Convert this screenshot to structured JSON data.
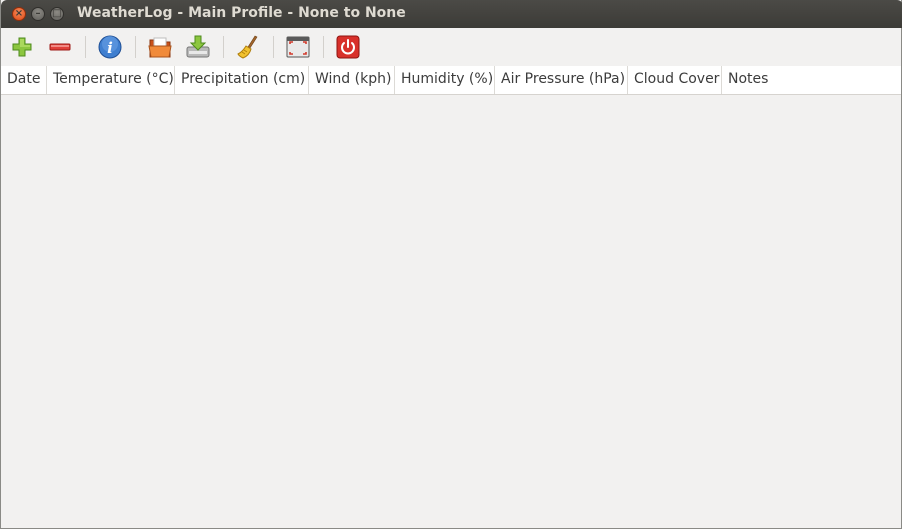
{
  "window": {
    "title": "WeatherLog - Main Profile - None to None"
  },
  "titlebar_buttons": {
    "close": "×",
    "minimize": "–",
    "maximize": "□"
  },
  "toolbar": {
    "items": [
      "add-icon",
      "remove-icon",
      "info-icon",
      "open-folder-icon",
      "import-icon",
      "clear-broom-icon",
      "fullscreen-icon",
      "quit-power-icon"
    ]
  },
  "table": {
    "columns": [
      "Date",
      "Temperature (°C)",
      "Precipitation (cm)",
      "Wind (kph)",
      "Humidity (%)",
      "Air Pressure (hPa)",
      "Cloud Cover",
      "Notes"
    ],
    "rows": []
  }
}
